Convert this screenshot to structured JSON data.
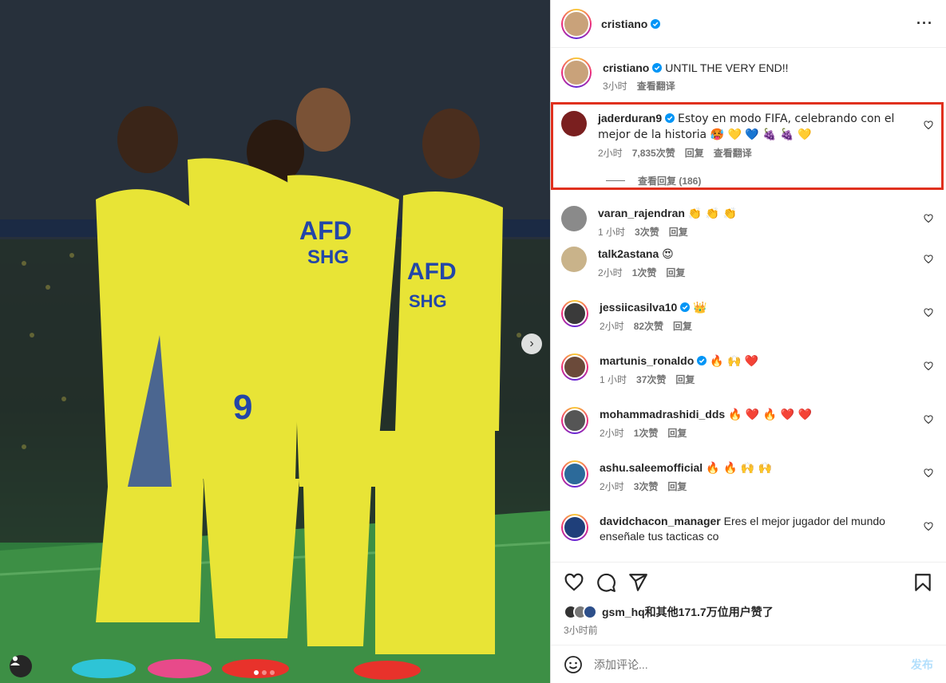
{
  "post": {
    "author": "cristiano",
    "caption_user": "cristiano",
    "caption_text": "UNTIL THE VERY END!!",
    "caption_time": "3小时",
    "translate_label": "查看翻译"
  },
  "comments": [
    {
      "user": "jaderduran9",
      "verified": true,
      "text": "Estoy en modo FIFA, celebrando con el mejor de la historia 🥵 💛 💙 🍇 🍇 💛",
      "time": "2小时",
      "likes": "7,835次赞",
      "reply": "回复",
      "translate": "查看翻译",
      "view_replies": "查看回复 (186)",
      "avatar_color": "#7a1f1f"
    },
    {
      "user": "varan_rajendran",
      "verified": false,
      "text": "👏 👏 👏",
      "time": "1 小时",
      "likes": "3次赞",
      "reply": "回复",
      "avatar_color": "#8a8a8a"
    },
    {
      "user": "talk2astana",
      "verified": false,
      "text": "😍",
      "time": "2小时",
      "likes": "1次赞",
      "reply": "回复",
      "avatar_color": "#c9b38a"
    },
    {
      "user": "jessiicasilva10",
      "verified": true,
      "text": "👑",
      "time": "2小时",
      "likes": "82次赞",
      "reply": "回复",
      "avatar_color": "#3a3a3a"
    },
    {
      "user": "martunis_ronaldo",
      "verified": true,
      "text": "🔥 🙌 ❤️",
      "time": "1 小时",
      "likes": "37次赞",
      "reply": "回复",
      "avatar_color": "#6b4a3a"
    },
    {
      "user": "mohammadrashidi_dds",
      "verified": false,
      "text": "🔥 ❤️ 🔥 ❤️ ❤️",
      "time": "2小时",
      "likes": "1次赞",
      "reply": "回复",
      "avatar_color": "#555555"
    },
    {
      "user": "ashu.saleemofficial",
      "verified": false,
      "text": "🔥 🔥 🙌 🙌",
      "time": "2小时",
      "likes": "3次赞",
      "reply": "回复",
      "avatar_color": "#2c6a9a"
    },
    {
      "user": "davidchacon_manager",
      "verified": false,
      "text": "Eres el mejor jugador del mundo enseñale tus tacticas co",
      "time": "",
      "likes": "",
      "reply": "",
      "avatar_color": "#1f3f7a"
    }
  ],
  "likes": {
    "text": "gsm_hq和其他171.7万位用户赞了"
  },
  "posted_time": "3小时前",
  "add_comment": {
    "placeholder": "添加评论...",
    "post_label": "发布"
  },
  "colors": {
    "highlight": "#e0301e",
    "verified": "#0095f6",
    "jersey": "#e8e436",
    "pitch": "#3d8f45"
  }
}
